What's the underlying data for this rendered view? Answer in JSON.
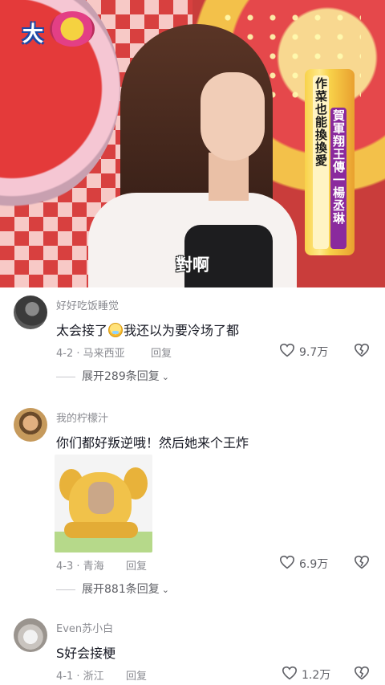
{
  "video": {
    "subtitle": "對啊",
    "sign_title": "作菜也能換換愛",
    "sign_names": "賀軍翔王傳一楊丞琳"
  },
  "comments": [
    {
      "username": "好好吃饭睡觉",
      "text_before": "太会接了",
      "text_after": "我还以为要冷场了都",
      "emoji_icon": "crying-laughing-emoji-icon",
      "date_location": "4-2 · 马来西亚",
      "reply_label": "回复",
      "likes": "9.7万",
      "expand_label": "展开289条回复"
    },
    {
      "username": "我的柠檬汁",
      "text": "你们都好叛逆哦！然后她来个王炸",
      "sticker_icon": "yellow-dog-meme-sticker",
      "date_location": "4-3 · 青海",
      "reply_label": "回复",
      "likes": "6.9万",
      "expand_label": "展开881条回复"
    },
    {
      "username": "Even苏小白",
      "text": "S好会接梗",
      "date_location": "4-1 · 浙江",
      "reply_label": "回复",
      "likes": "1.2万"
    }
  ],
  "colors": {
    "text_primary": "#161823",
    "text_secondary": "#8a8b91",
    "background": "#ffffff"
  }
}
